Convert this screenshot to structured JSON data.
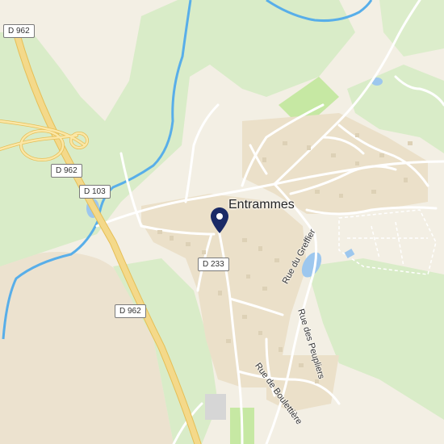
{
  "map": {
    "place_name": "Entrammes",
    "road_labels": [
      "D 962",
      "D 962",
      "D 103",
      "D 233",
      "D 962"
    ],
    "street_labels": [
      "Rue du Greffier",
      "Rue des Peupliers",
      "Rue de Boulettière"
    ],
    "marker_icon": "location-pin-icon",
    "colors": {
      "land": "#f3efe4",
      "green": "#d9ecc8",
      "water": "#9dc7ee",
      "river": "#58aee9",
      "major_road": "#f4d98a",
      "major_road_edge": "#e6be55",
      "minor_road": "#ffffff",
      "building": "#e7dcc6",
      "marker": "#1a2a66"
    }
  }
}
